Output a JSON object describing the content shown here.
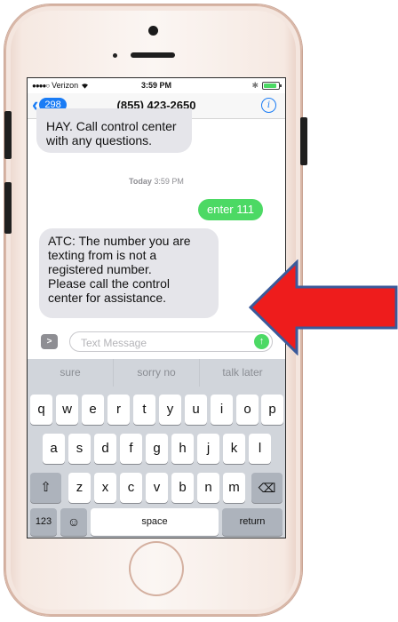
{
  "status_bar": {
    "carrier": "Verizon",
    "time": "3:59 PM",
    "signal_icon": "signal-dots-icon",
    "wifi_icon": "wifi-icon",
    "bluetooth_icon": "bluetooth-icon",
    "battery_icon": "battery-icon",
    "battery_level": 0.9
  },
  "nav": {
    "back_count": "298",
    "title": "(855) 423-2650",
    "info_icon": "info-icon"
  },
  "messages": {
    "m1": {
      "line1": "HAY. Call control center",
      "line2": "with any questions."
    },
    "timestamp": {
      "day": "Today",
      "time": "3:59 PM"
    },
    "m2": "enter 111",
    "m3": {
      "line1": "ATC: The number you are",
      "line2": "texting from is not a",
      "line3": "registered number.",
      "line4": "Please call the control",
      "line5": "center for assistance."
    }
  },
  "composer": {
    "placeholder": "Text Message",
    "camera_icon": "apps-chevron-icon",
    "send_icon": "send-arrow-icon"
  },
  "suggestions": [
    "sure",
    "sorry no",
    "talk later"
  ],
  "keyboard": {
    "row1": [
      "q",
      "w",
      "e",
      "r",
      "t",
      "y",
      "u",
      "i",
      "o",
      "p"
    ],
    "row2": [
      "a",
      "s",
      "d",
      "f",
      "g",
      "h",
      "j",
      "k",
      "l"
    ],
    "row3": [
      "z",
      "x",
      "c",
      "v",
      "b",
      "n",
      "m"
    ],
    "shift_icon": "shift-icon",
    "delete_icon": "delete-icon",
    "numbers": "123",
    "emoji_icon": "emoji-icon",
    "space": "space",
    "return": "return"
  },
  "colors": {
    "imessage_green": "#4cd964",
    "ios_blue": "#1a7cf5",
    "arrow_red": "#ee1c1c",
    "arrow_outline": "#3b5a9a"
  }
}
